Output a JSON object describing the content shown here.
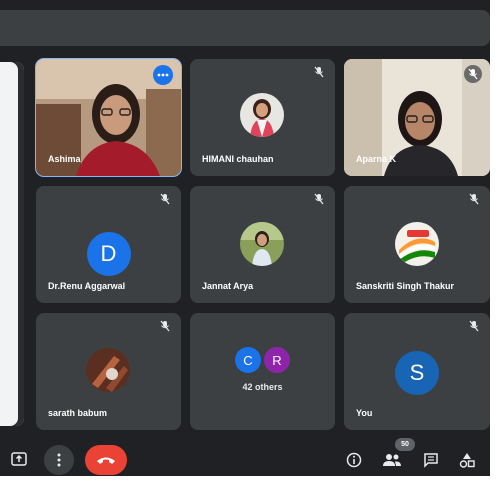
{
  "participants": [
    {
      "name": "Ashima",
      "kind": "video",
      "state": "speaking"
    },
    {
      "name": "HIMANI chauhan",
      "kind": "photo",
      "muted": true
    },
    {
      "name": "Aparna K",
      "kind": "video",
      "muted": true
    },
    {
      "name": "Dr.Renu Aggarwal",
      "kind": "letter",
      "initial": "D",
      "color": "#1a73e8",
      "muted": true
    },
    {
      "name": "Jannat Arya",
      "kind": "photo",
      "muted": true
    },
    {
      "name": "Sanskriti Singh Thakur",
      "kind": "photo",
      "muted": true
    },
    {
      "name": "sarath babum",
      "kind": "photo",
      "muted": true
    },
    {
      "name": "You",
      "kind": "letter",
      "initial": "S",
      "color": "#1765b4",
      "muted": true
    }
  ],
  "others": {
    "label": "42 others",
    "avatars": [
      {
        "initial": "C",
        "color": "#1a73e8"
      },
      {
        "initial": "R",
        "color": "#8e24aa"
      }
    ]
  },
  "controls": {
    "participant_count": "50",
    "icons": [
      "present-icon",
      "more-options-icon",
      "end-call-icon",
      "info-icon",
      "people-icon",
      "chat-icon",
      "activities-icon"
    ]
  },
  "colors": {
    "background": "#202124",
    "tile": "#3c4043",
    "active_outline": "#8ab4f8",
    "end_call": "#ea4335"
  }
}
